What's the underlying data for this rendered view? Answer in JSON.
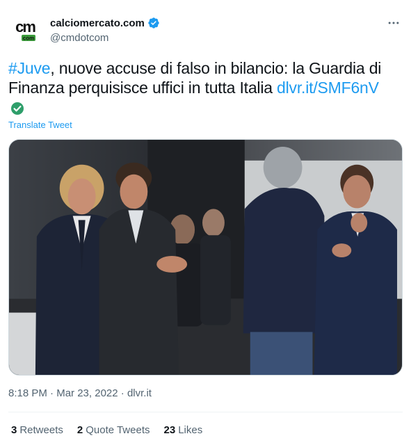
{
  "author": {
    "display_name": "calciomercato.com",
    "handle": "@cmdotcom",
    "verified_icon": "verified-badge-icon",
    "avatar_logo": "cm com",
    "accent": "#1d9bf0"
  },
  "tweet": {
    "hashtag": "#Juve",
    "text": ", nuove accuse di falso in bilancio: la Guardia di Finanza perquisisce uffici in tutta Italia ",
    "link": "dlvr.it/SMF6nV",
    "emoji_icon": "check-mark-button-icon",
    "translate_label": "Translate Tweet"
  },
  "meta": {
    "time": "8:18 PM",
    "separator": "·",
    "date": "Mar 23, 2022",
    "source": "dlvr.it"
  },
  "stats": [
    {
      "count": "3",
      "label": "Retweets"
    },
    {
      "count": "2",
      "label": "Quote Tweets"
    },
    {
      "count": "23",
      "label": "Likes"
    }
  ]
}
